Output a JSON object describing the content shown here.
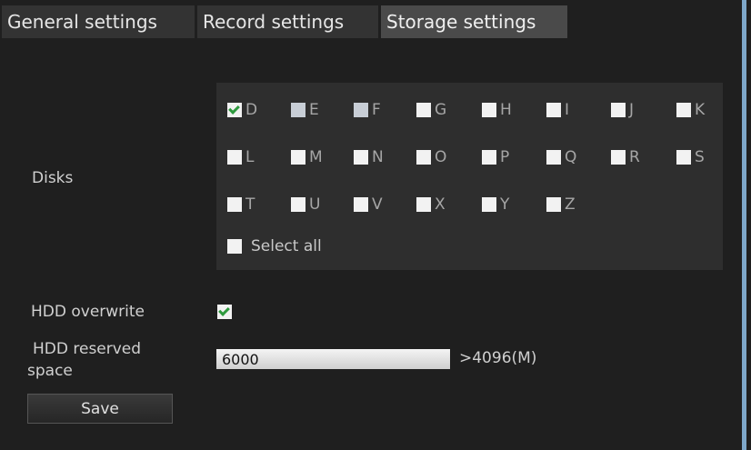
{
  "tabs": [
    {
      "label": "General settings",
      "active": false
    },
    {
      "label": "Record settings",
      "active": false
    },
    {
      "label": "Storage settings",
      "active": true
    }
  ],
  "disks": {
    "label": "Disks",
    "items": [
      {
        "letter": "D",
        "checked": true,
        "state": "checked"
      },
      {
        "letter": "E",
        "checked": false,
        "state": "disabled"
      },
      {
        "letter": "F",
        "checked": false,
        "state": "disabled"
      },
      {
        "letter": "G",
        "checked": false,
        "state": "unchecked"
      },
      {
        "letter": "H",
        "checked": false,
        "state": "unchecked"
      },
      {
        "letter": "I",
        "checked": false,
        "state": "unchecked"
      },
      {
        "letter": "J",
        "checked": false,
        "state": "unchecked"
      },
      {
        "letter": "K",
        "checked": false,
        "state": "unchecked"
      },
      {
        "letter": "L",
        "checked": false,
        "state": "unchecked"
      },
      {
        "letter": "M",
        "checked": false,
        "state": "unchecked"
      },
      {
        "letter": "N",
        "checked": false,
        "state": "unchecked"
      },
      {
        "letter": "O",
        "checked": false,
        "state": "unchecked"
      },
      {
        "letter": "P",
        "checked": false,
        "state": "unchecked"
      },
      {
        "letter": "Q",
        "checked": false,
        "state": "unchecked"
      },
      {
        "letter": "R",
        "checked": false,
        "state": "unchecked"
      },
      {
        "letter": "S",
        "checked": false,
        "state": "unchecked"
      },
      {
        "letter": "T",
        "checked": false,
        "state": "unchecked"
      },
      {
        "letter": "U",
        "checked": false,
        "state": "unchecked"
      },
      {
        "letter": "V",
        "checked": false,
        "state": "unchecked"
      },
      {
        "letter": "X",
        "checked": false,
        "state": "unchecked"
      },
      {
        "letter": "Y",
        "checked": false,
        "state": "unchecked"
      },
      {
        "letter": "Z",
        "checked": false,
        "state": "unchecked"
      }
    ],
    "select_all_label": "Select all",
    "select_all_checked": false
  },
  "hdd_overwrite": {
    "label": "HDD overwrite",
    "checked": true
  },
  "hdd_reserved": {
    "label_line1": "HDD reserved",
    "label_line2": "space",
    "value": "6000",
    "hint": ">4096(M)"
  },
  "save_label": "Save",
  "colors": {
    "background": "#1f1f1f",
    "active_tab": "#4a4a4a",
    "check_green": "#2e9a3e",
    "window_border": "#7ea7c9"
  }
}
